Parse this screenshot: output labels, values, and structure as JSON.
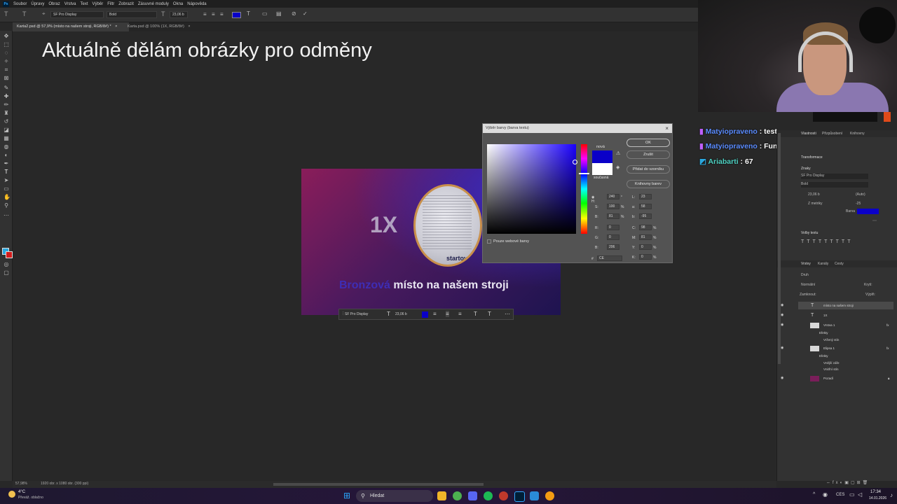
{
  "menubar": {
    "items": [
      "Soubor",
      "Úpravy",
      "Obraz",
      "Vrstva",
      "Text",
      "Výběr",
      "Filtr",
      "Zobrazit",
      "Zásuvné moduly",
      "Okna",
      "Nápověda"
    ]
  },
  "options": {
    "font": "SF Pro Display",
    "style": "Bold",
    "size": "23,06 b",
    "color": "#0a00c8"
  },
  "tabs": [
    {
      "label": "Karta2.psd @ 57,9% (místo na našem stroji, RGB/8#) *"
    },
    {
      "label": "Karta.psd @ 100% (1X, RGB/8#)"
    }
  ],
  "heading": "Aktuálně dělám obrázky pro odměny",
  "card": {
    "multiplier": "1X",
    "logo": "startovač",
    "highlight": "Bronzová",
    "rest": " místo na našem stroji"
  },
  "ctxbar": {
    "font": "SF Pro Display",
    "size": "23,06 b"
  },
  "dialog": {
    "title": "Výběr barvy (barva textu)",
    "new_label": "nová",
    "current_label": "současná",
    "buttons": {
      "ok": "OK",
      "cancel": "Zrušit",
      "add": "Přidat do vzorníku",
      "libraries": "Knihovny barev"
    },
    "web_only": "Pouze webové barvy",
    "hsb": {
      "h": "240",
      "s": "100",
      "b": "81"
    },
    "rgb": {
      "r": "0",
      "g": "0",
      "b": "206"
    },
    "lab": {
      "l": "23",
      "a": "58",
      "b": "-95"
    },
    "cmyk": {
      "c": "98",
      "m": "81",
      "y": "0",
      "k": "0"
    },
    "hex": "CE"
  },
  "chat": [
    {
      "user": "Matyiopraveno",
      "msg": " : test",
      "color": "#5b8cff"
    },
    {
      "user": "Matyiopraveno",
      "msg": " : Funkční chat hihi",
      "color": "#5b8cff"
    },
    {
      "user": "Ariabarti",
      "msg": " : 67",
      "color": "#4fd3c4"
    }
  ],
  "props": {
    "tabs": [
      "Vlastnosti",
      "Přizpůsobení",
      "Knihovny"
    ],
    "transform": "Transformace",
    "char": "Znaky",
    "font": "SF Pro Display",
    "style": "Bold",
    "size": "23,06 b",
    "leading": "(Auto)",
    "metrics": "Z metriky",
    "tracking": "-25",
    "color_label": "Barva",
    "para": "Volby textu"
  },
  "layers": {
    "tabs": [
      "Vrstvy",
      "Kanály",
      "Cesty"
    ],
    "search": "Druh",
    "mode": "Normální",
    "opacity_label": "Krytí:",
    "lock_label": "Zamknout:",
    "fill_label": "Výplň:",
    "items": [
      {
        "name": "místo na našem stroji"
      },
      {
        "name": "1X"
      },
      {
        "name": "Vrstva 1"
      },
      {
        "name": "Efekty"
      },
      {
        "name": "Vržený stín"
      },
      {
        "name": "Elipsa 1"
      },
      {
        "name": "Efekty"
      },
      {
        "name": "Vnější záře"
      },
      {
        "name": "Vnitřní stín"
      },
      {
        "name": "Pozadí"
      }
    ]
  },
  "status": {
    "zoom": "57,98%",
    "doc": "1920 obr. x 1080 obr. (300 ppi)"
  },
  "taskbar": {
    "weather_temp": "4°C",
    "weather_desc": "Převáž. oblačno",
    "search": "Hledat",
    "lang": "CES",
    "time": "17:34",
    "date": "14.01.2026"
  }
}
